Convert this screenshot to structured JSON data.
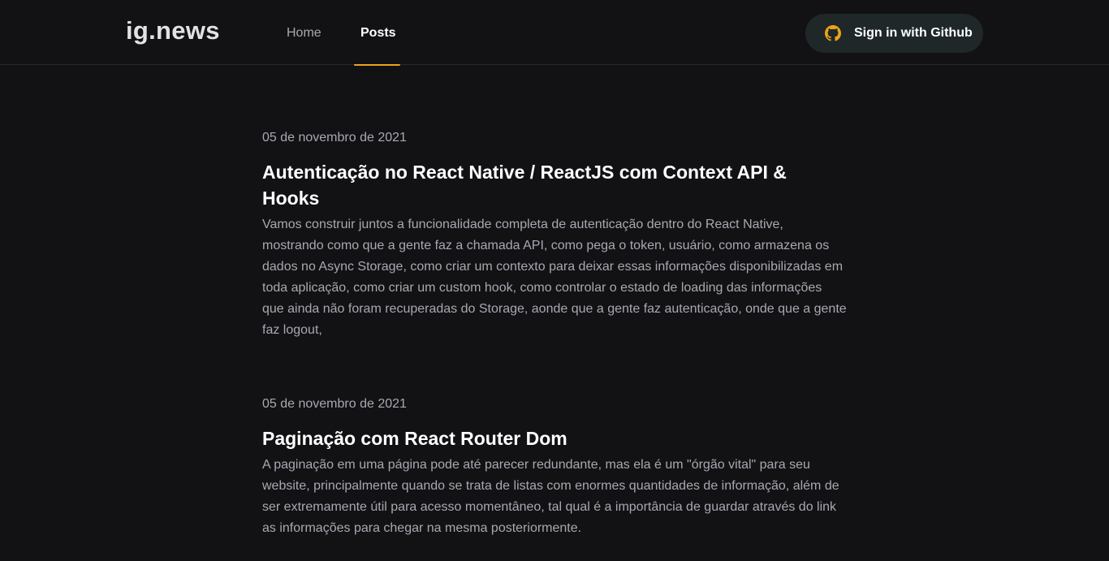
{
  "header": {
    "logo": "ig.news",
    "nav": [
      {
        "label": "Home"
      },
      {
        "label": "Posts"
      }
    ],
    "signin_label": "Sign in with Github"
  },
  "posts": [
    {
      "date": "05 de novembro de 2021",
      "title": "Autenticação no React Native / ReactJS com Context API & Hooks",
      "excerpt": "Vamos construir juntos a funcionalidade completa de autenticação dentro do React Native, mostrando como que a gente faz a chamada API, como pega o token, usuário, como armazena os dados no Async Storage, como criar um contexto para deixar essas informações disponibilizadas em toda aplicação, como  criar um custom hook, como controlar o estado de loading das informações que ainda não foram recuperadas do Storage, aonde que a gente faz autenticação, onde que a gente faz logout,"
    },
    {
      "date": "05 de novembro de 2021",
      "title": "Paginação com React Router Dom",
      "excerpt": "A paginação em uma página pode até parecer redundante, mas ela é um \"órgão vital\" para seu website, principalmente quando se trata de listas com enormes quantidades de informação, além de ser extremamente útil para acesso momentâneo, tal qual é a importância de guardar através do link as informações para chegar na mesma posteriormente."
    }
  ],
  "colors": {
    "background": "#121214",
    "accent": "#eba417",
    "button_bg": "#1f2729"
  },
  "icons": {
    "signin": "github-icon"
  }
}
